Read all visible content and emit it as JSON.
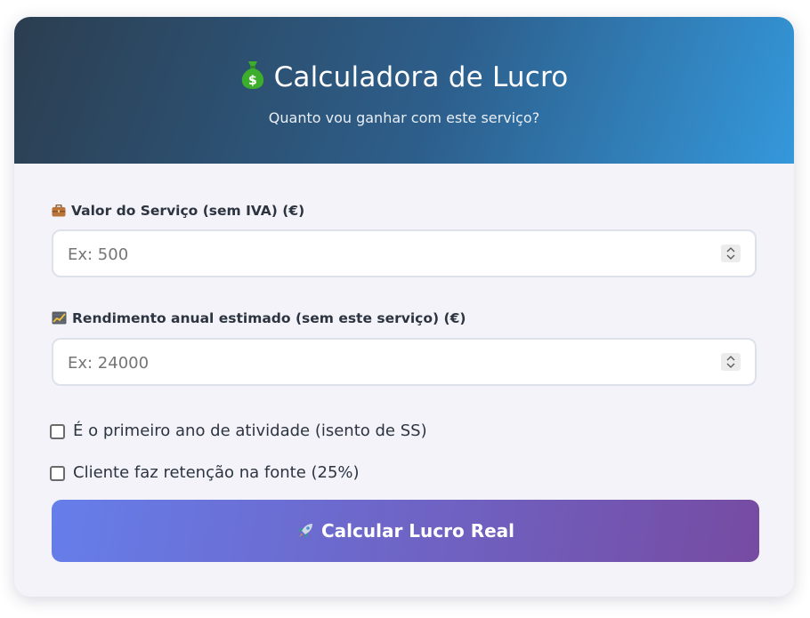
{
  "header": {
    "title": "Calculadora de Lucro",
    "subtitle": "Quanto vou ganhar com este serviço?",
    "title_icon": "money-bag-icon"
  },
  "form": {
    "service_value": {
      "label": "Valor do Serviço (sem IVA) (€)",
      "icon": "briefcase-icon",
      "placeholder": "Ex: 500",
      "value": ""
    },
    "annual_income": {
      "label": "Rendimento anual estimado (sem este serviço) (€)",
      "icon": "chart-increasing-icon",
      "placeholder": "Ex: 24000",
      "value": ""
    },
    "first_year": {
      "label": "É o primeiro ano de atividade (isento de SS)",
      "checked": false
    },
    "withholding": {
      "label": "Cliente faz retenção na fonte (25%)",
      "checked": false
    },
    "submit": {
      "label": "Calcular Lucro Real",
      "icon": "rocket-icon"
    }
  },
  "colors": {
    "header_gradient_start": "#2c3e50",
    "header_gradient_end": "#3498db",
    "button_gradient_start": "#667eea",
    "button_gradient_end": "#764ba2",
    "card_background": "#f4f3fa"
  }
}
